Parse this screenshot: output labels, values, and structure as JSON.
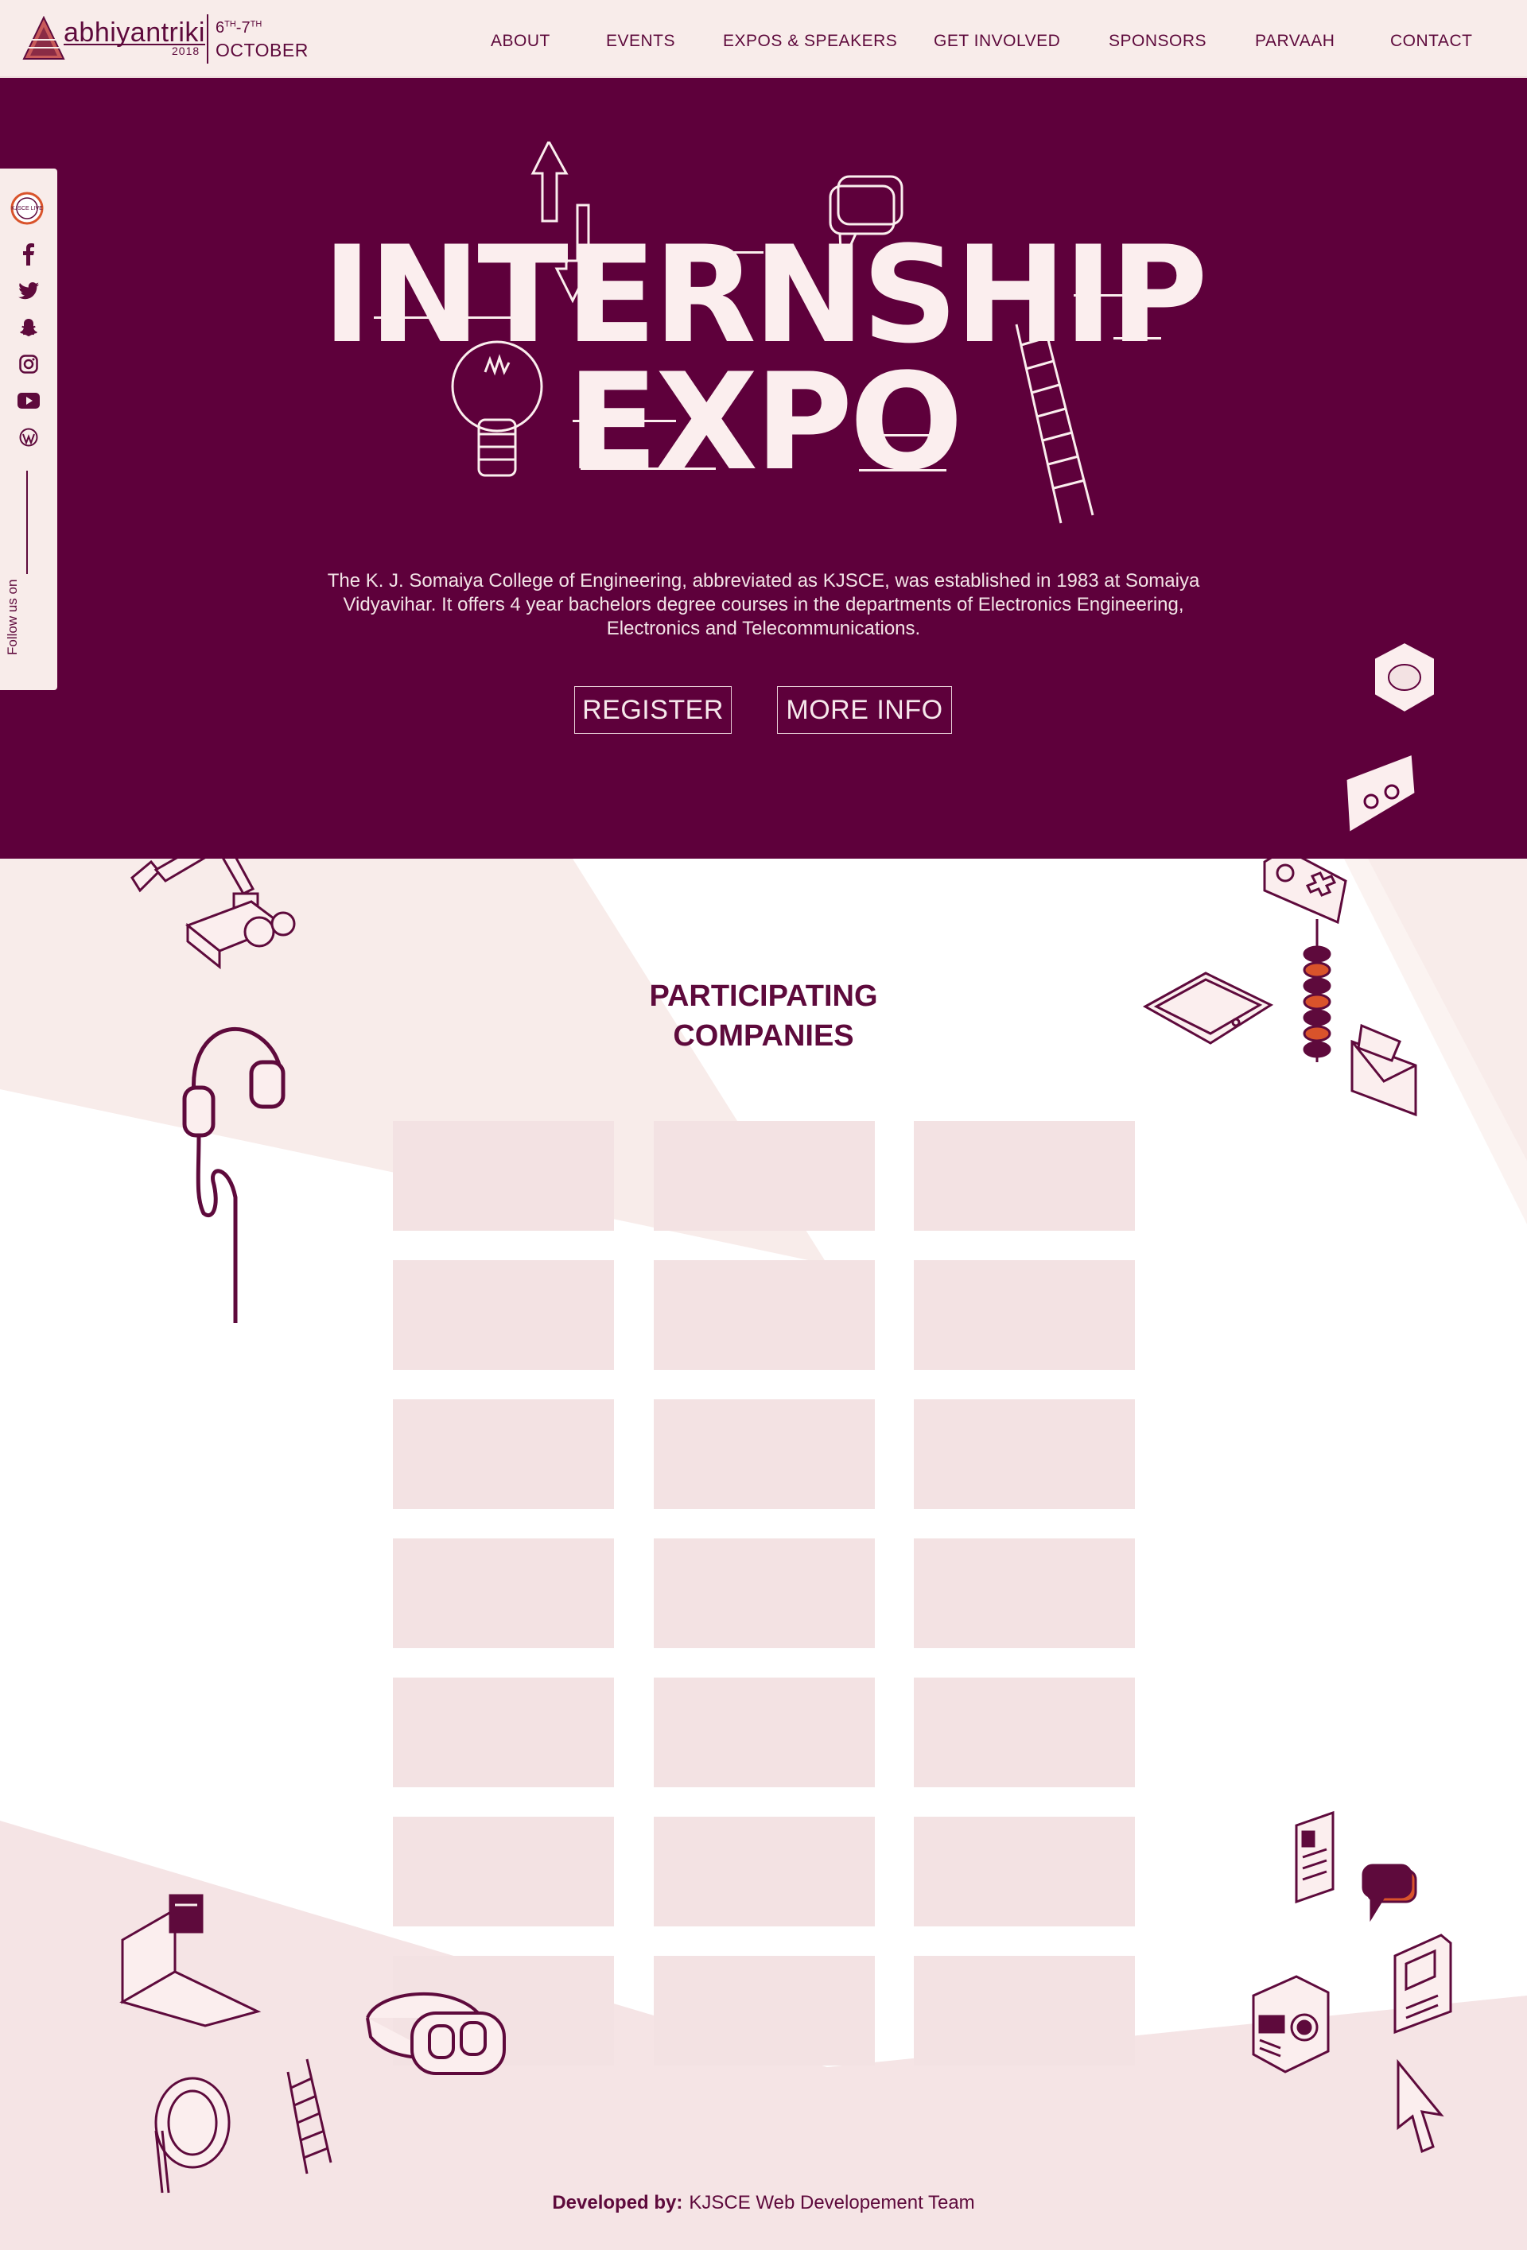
{
  "header": {
    "logo_name": "abhiyantriki",
    "logo_year": "2018",
    "date_from": "6",
    "date_from_sup": "TH",
    "date_sep": "-",
    "date_to": "7",
    "date_to_sup": "TH",
    "month": "OCTOBER",
    "nav": [
      "ABOUT",
      "EVENTS",
      "EXPOS & SPEAKERS",
      "GET INVOLVED",
      "SPONSORS",
      "PARVAAH",
      "CONTACT"
    ]
  },
  "hero": {
    "title_line1": "INTERNSHIP",
    "title_line2": "EXPO",
    "description": "The K. J. Somaiya College of Engineering, abbreviated as KJSCE, was established in 1983 at Somaiya Vidyavihar. It offers 4 year bachelors degree courses in the departments of Electronics Engineering, Electronics and Telecommunications.",
    "register_label": "REGISTER",
    "more_info_label": "MORE INFO"
  },
  "social": {
    "badge_text": "KJSCE LIVE",
    "icons": [
      "kjsce-live-icon",
      "facebook-icon",
      "twitter-icon",
      "snapchat-icon",
      "instagram-icon",
      "youtube-icon",
      "wordpress-icon"
    ],
    "follow_label": "Follow us on"
  },
  "companies": {
    "title_line1": "PARTICIPATING",
    "title_line2": "COMPANIES",
    "rows": 7,
    "cols": 3
  },
  "footer": {
    "developed_by_label": "Developed by:",
    "team": "KJSCE Web Developement Team"
  },
  "colors": {
    "primary": "#5e003b",
    "header_bg": "#f8ecea",
    "cell_bg": "#f3e2e3",
    "accent_orange": "#d9532b",
    "light_text": "#fbeeee"
  }
}
